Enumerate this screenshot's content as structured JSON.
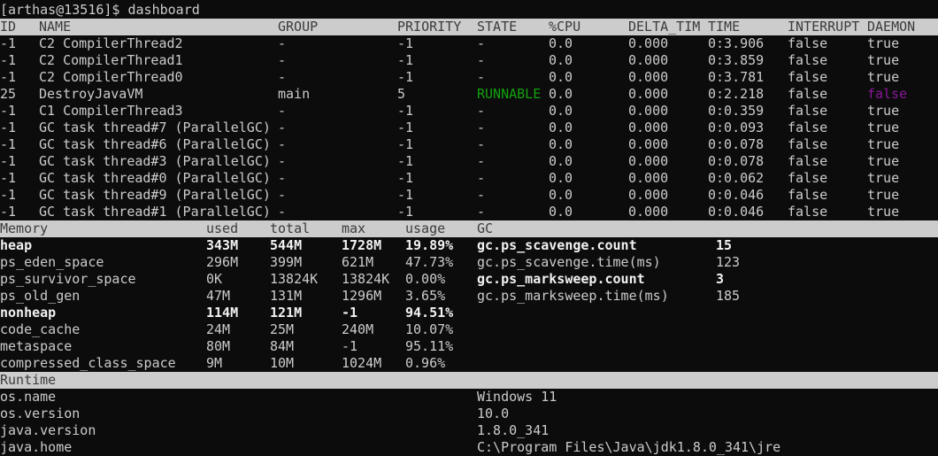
{
  "prompt": "[arthas@13516]$ dashboard",
  "thread_table": {
    "headers": [
      "ID",
      "NAME",
      "GROUP",
      "PRIORITY",
      "STATE",
      "%CPU",
      "DELTA_TIM",
      "TIME",
      "INTERRUPT",
      "DAEMON"
    ],
    "rows": [
      [
        "-1",
        "C2 CompilerThread2",
        "-",
        "-1",
        "-",
        "0.0",
        "0.000",
        "0:3.906",
        "false",
        "true"
      ],
      [
        "-1",
        "C2 CompilerThread1",
        "-",
        "-1",
        "-",
        "0.0",
        "0.000",
        "0:3.859",
        "false",
        "true"
      ],
      [
        "-1",
        "C2 CompilerThread0",
        "-",
        "-1",
        "-",
        "0.0",
        "0.000",
        "0:3.781",
        "false",
        "true"
      ],
      [
        "25",
        "DestroyJavaVM",
        "main",
        "5",
        "RUNNABLE",
        "0.0",
        "0.000",
        "0:2.218",
        "false",
        "false"
      ],
      [
        "-1",
        "C1 CompilerThread3",
        "-",
        "-1",
        "-",
        "0.0",
        "0.000",
        "0:0.359",
        "false",
        "true"
      ],
      [
        "-1",
        "GC task thread#7 (ParallelGC)",
        "-",
        "-1",
        "-",
        "0.0",
        "0.000",
        "0:0.093",
        "false",
        "true"
      ],
      [
        "-1",
        "GC task thread#6 (ParallelGC)",
        "-",
        "-1",
        "-",
        "0.0",
        "0.000",
        "0:0.078",
        "false",
        "true"
      ],
      [
        "-1",
        "GC task thread#3 (ParallelGC)",
        "-",
        "-1",
        "-",
        "0.0",
        "0.000",
        "0:0.078",
        "false",
        "true"
      ],
      [
        "-1",
        "GC task thread#0 (ParallelGC)",
        "-",
        "-1",
        "-",
        "0.0",
        "0.000",
        "0:0.062",
        "false",
        "true"
      ],
      [
        "-1",
        "GC task thread#9 (ParallelGC)",
        "-",
        "-1",
        "-",
        "0.0",
        "0.000",
        "0:0.046",
        "false",
        "true"
      ],
      [
        "-1",
        "GC task thread#1 (ParallelGC)",
        "-",
        "-1",
        "-",
        "0.0",
        "0.000",
        "0:0.046",
        "false",
        "true"
      ]
    ]
  },
  "memory_table": {
    "headers": [
      "Memory",
      "used",
      "total",
      "max",
      "usage",
      "GC"
    ],
    "rows": [
      {
        "cells": [
          "heap",
          "343M",
          "544M",
          "1728M",
          "19.89%"
        ],
        "bold": true
      },
      {
        "cells": [
          "ps_eden_space",
          "296M",
          "399M",
          "621M",
          "47.73%"
        ],
        "bold": false
      },
      {
        "cells": [
          "ps_survivor_space",
          "0K",
          "13824K",
          "13824K",
          "0.00%"
        ],
        "bold": false
      },
      {
        "cells": [
          "ps_old_gen",
          "47M",
          "131M",
          "1296M",
          "3.65%"
        ],
        "bold": false
      },
      {
        "cells": [
          "nonheap",
          "114M",
          "121M",
          "-1",
          "94.51%"
        ],
        "bold": true
      },
      {
        "cells": [
          "code_cache",
          "24M",
          "25M",
          "240M",
          "10.07%"
        ],
        "bold": false
      },
      {
        "cells": [
          "metaspace",
          "80M",
          "84M",
          "-1",
          "95.11%"
        ],
        "bold": false
      },
      {
        "cells": [
          "compressed_class_space",
          "9M",
          "10M",
          "1024M",
          "0.96%"
        ],
        "bold": false
      }
    ],
    "gc": [
      {
        "key": "gc.ps_scavenge.count",
        "value": "15",
        "bold": true
      },
      {
        "key": "gc.ps_scavenge.time(ms)",
        "value": "123",
        "bold": false
      },
      {
        "key": "gc.ps_marksweep.count",
        "value": "3",
        "bold": true
      },
      {
        "key": "gc.ps_marksweep.time(ms)",
        "value": "185",
        "bold": false
      }
    ]
  },
  "runtime_table": {
    "header": "Runtime",
    "rows": [
      [
        "os.name",
        "Windows 11"
      ],
      [
        "os.version",
        "10.0"
      ],
      [
        "java.version",
        "1.8.0_341"
      ],
      [
        "java.home",
        "C:\\Program Files\\Java\\jdk1.8.0_341\\jre"
      ]
    ]
  },
  "colors": {
    "background": "#0c0c0c",
    "text": "#cccccc",
    "header_bar": "#cccccc",
    "runnable": "#13a10e",
    "daemon_false": "#881798"
  }
}
